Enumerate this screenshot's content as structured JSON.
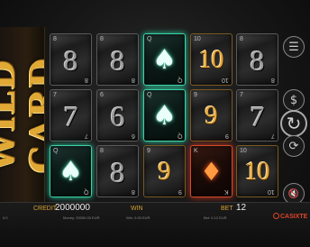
{
  "logo": {
    "text": "WILD CARD"
  },
  "reels": [
    {
      "rank": "8",
      "corner": "8",
      "kind": "plain"
    },
    {
      "rank": "8",
      "corner": "8",
      "kind": "plain"
    },
    {
      "rank": "♠",
      "corner": "Q",
      "kind": "spade"
    },
    {
      "rank": "10",
      "corner": "10",
      "kind": "gold"
    },
    {
      "rank": "8",
      "corner": "8",
      "kind": "plain"
    },
    {
      "rank": "7",
      "corner": "7",
      "kind": "plain"
    },
    {
      "rank": "6",
      "corner": "6",
      "kind": "plain"
    },
    {
      "rank": "♠",
      "corner": "Q",
      "kind": "spade"
    },
    {
      "rank": "9",
      "corner": "9",
      "kind": "gold"
    },
    {
      "rank": "7",
      "corner": "7",
      "kind": "plain"
    },
    {
      "rank": "♠",
      "corner": "Q",
      "kind": "spade"
    },
    {
      "rank": "8",
      "corner": "8",
      "kind": "plain"
    },
    {
      "rank": "9",
      "corner": "9",
      "kind": "gold"
    },
    {
      "rank": "♦",
      "corner": "K",
      "kind": "diamond"
    },
    {
      "rank": "10",
      "corner": "10",
      "kind": "gold"
    }
  ],
  "side": {
    "menu_icon": "☰",
    "coin_icon": "$",
    "spin_icon": "↻",
    "autoplay_icon": "⟳",
    "mute_icon": "🔇"
  },
  "bottom": {
    "credit_label": "CREDIT",
    "credit_value": "2000000",
    "win_label": "WIN",
    "bet_label": "BET",
    "bet_value": "12",
    "money_text": "Money: 20000.00 EUR",
    "win_small": "Win: 0.00 EUR",
    "bet_small": "Bet: 0.12 EUR",
    "left_small": "0:0",
    "brand": "CASIXTE"
  }
}
